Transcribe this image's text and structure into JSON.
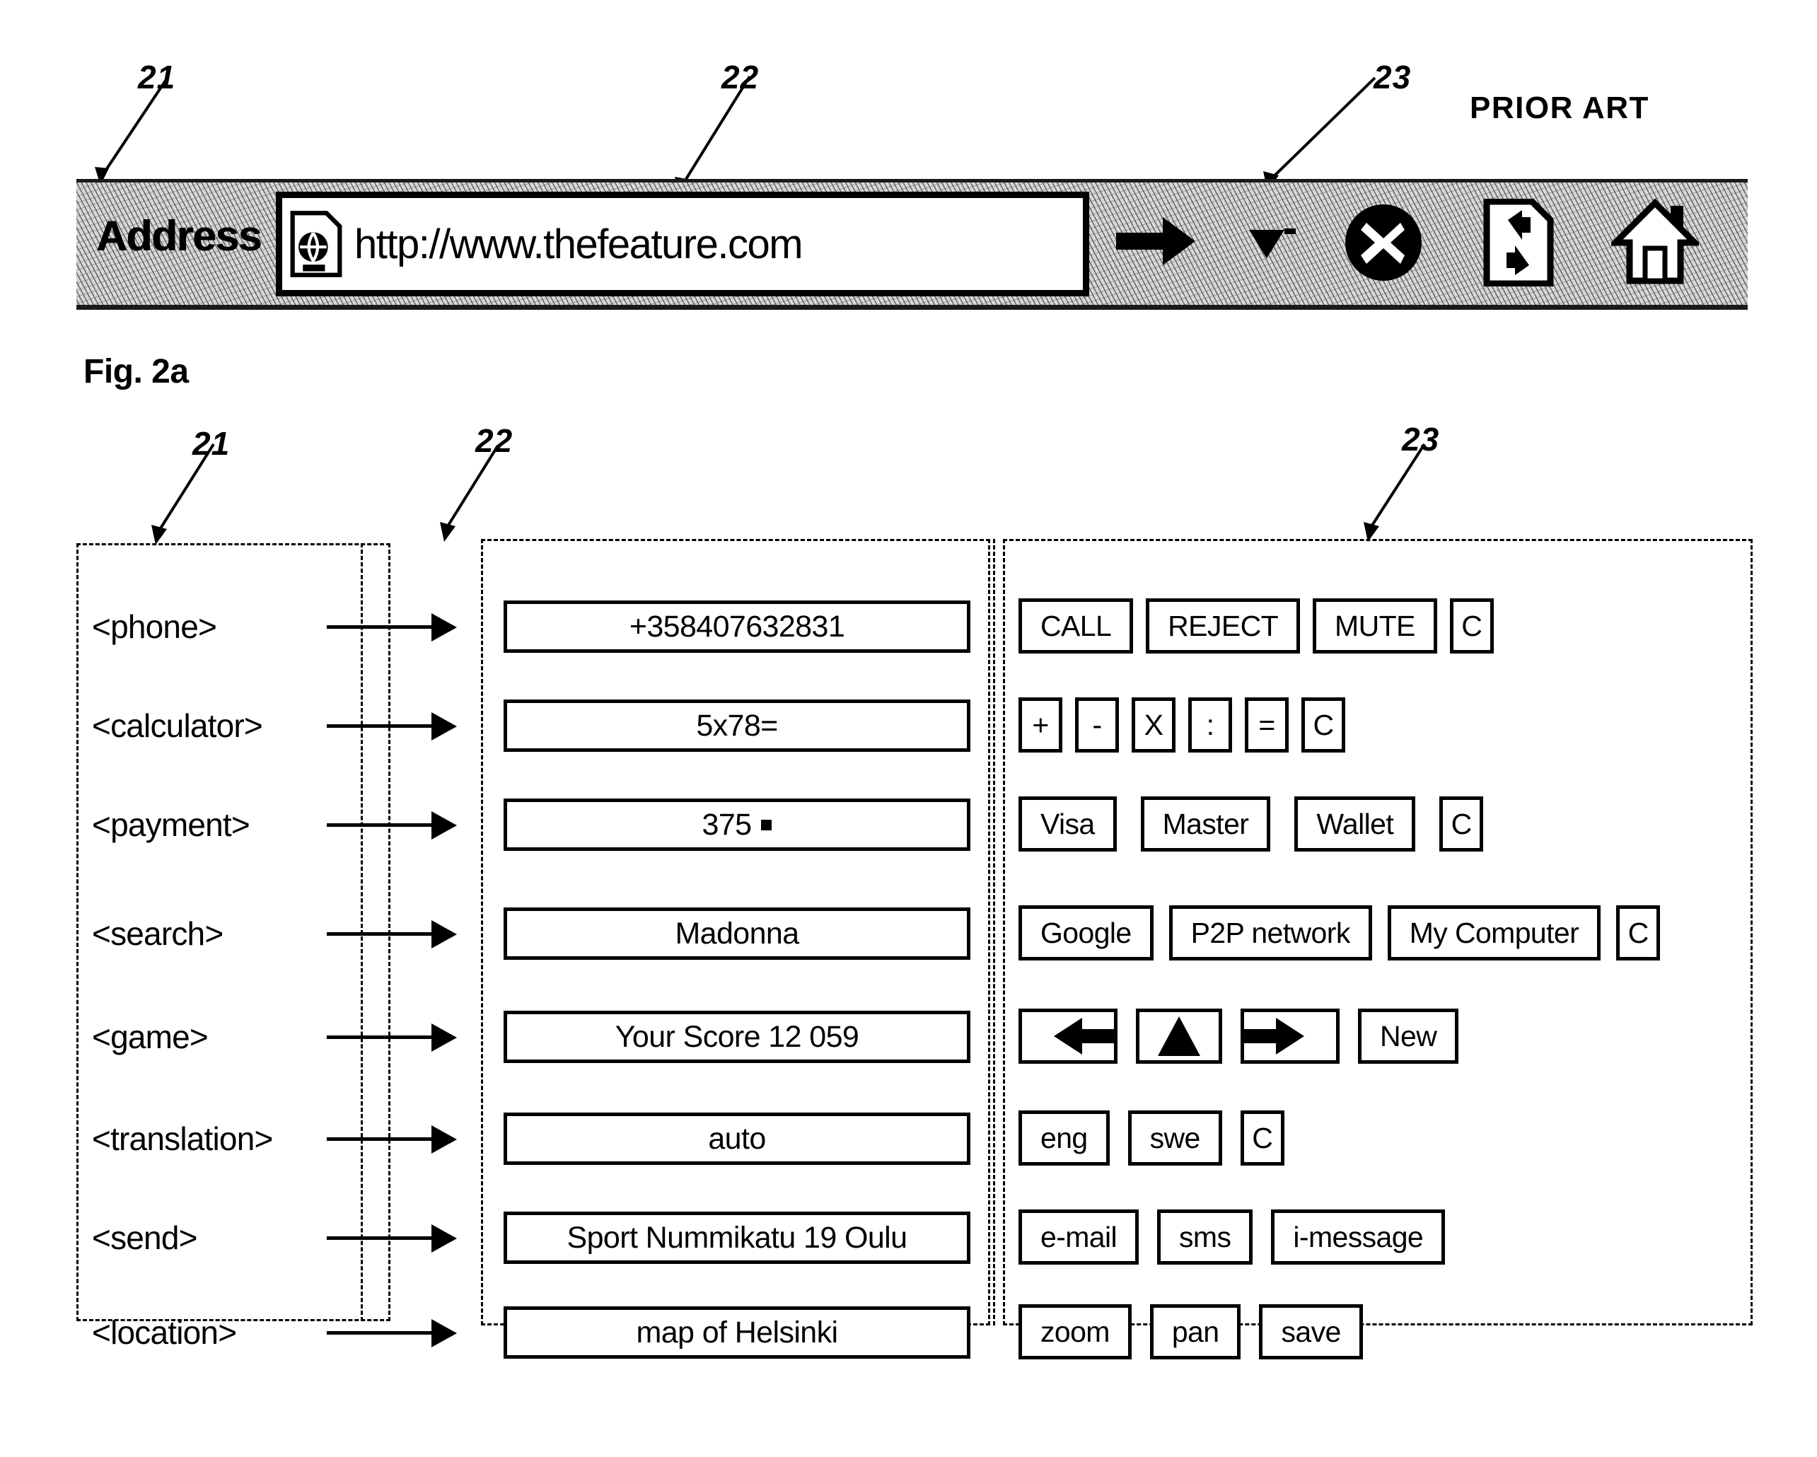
{
  "prior_art_label": "PRIOR ART",
  "fig_label": "Fig. 2a",
  "address_bar": {
    "label": "Address",
    "url": "http://www.thefeature.com",
    "favicon_icon": "document-globe-icon",
    "ref_21": "21",
    "ref_22": "22",
    "ref_23": "23",
    "icons": [
      {
        "name": "go-arrow-icon",
        "label": "Go"
      },
      {
        "name": "chevron-down-icon",
        "label": "History dropdown"
      },
      {
        "name": "stop-circle-x-icon",
        "label": "Stop"
      },
      {
        "name": "refresh-page-icon",
        "label": "Refresh"
      },
      {
        "name": "home-icon",
        "label": "Home"
      }
    ]
  },
  "diagram": {
    "ref_21": "21",
    "ref_22": "22",
    "ref_23": "23",
    "rows": [
      {
        "tag": "<phone>",
        "value": "+358407632831",
        "buttons": [
          {
            "label": "CALL",
            "kind": "wide"
          },
          {
            "label": "REJECT",
            "kind": "wide"
          },
          {
            "label": "MUTE",
            "kind": "wide"
          },
          {
            "label": "C",
            "kind": "square"
          }
        ]
      },
      {
        "tag": "<calculator>",
        "value": "5x78=",
        "buttons": [
          {
            "label": "+",
            "kind": "square"
          },
          {
            "label": "-",
            "kind": "square"
          },
          {
            "label": "X",
            "kind": "square"
          },
          {
            "label": ":",
            "kind": "square"
          },
          {
            "label": "=",
            "kind": "square"
          },
          {
            "label": "C",
            "kind": "square"
          }
        ]
      },
      {
        "tag": "<payment>",
        "value": "375",
        "value_suffix_icon": "square-bullet-icon",
        "buttons": [
          {
            "label": "Visa",
            "kind": "wide"
          },
          {
            "label": "Master",
            "kind": "wide"
          },
          {
            "label": "Wallet",
            "kind": "wide"
          },
          {
            "label": "C",
            "kind": "square"
          }
        ]
      },
      {
        "tag": "<search>",
        "value": "Madonna",
        "buttons": [
          {
            "label": "Google",
            "kind": "wide"
          },
          {
            "label": "P2P network",
            "kind": "wide"
          },
          {
            "label": "My Computer",
            "kind": "wide"
          },
          {
            "label": "C",
            "kind": "square"
          }
        ]
      },
      {
        "tag": "<game>",
        "value": "Your Score 12 059",
        "buttons": [
          {
            "label": "",
            "kind": "arrowbtn",
            "icon": "arrow-left-icon"
          },
          {
            "label": "",
            "kind": "arrowbtn",
            "icon": "arrow-up-icon"
          },
          {
            "label": "",
            "kind": "arrowbtn",
            "icon": "arrow-right-icon"
          },
          {
            "label": "New",
            "kind": "wide"
          }
        ]
      },
      {
        "tag": "<translation>",
        "value": "auto",
        "buttons": [
          {
            "label": "eng",
            "kind": "wide"
          },
          {
            "label": "swe",
            "kind": "wide"
          },
          {
            "label": "C",
            "kind": "square"
          }
        ]
      },
      {
        "tag": "<send>",
        "value": "Sport Nummikatu 19 Oulu",
        "buttons": [
          {
            "label": "e-mail",
            "kind": "wide"
          },
          {
            "label": "sms",
            "kind": "wide"
          },
          {
            "label": "i-message",
            "kind": "wide"
          }
        ]
      },
      {
        "tag": "<location>",
        "value": "map of Helsinki",
        "buttons": [
          {
            "label": "zoom",
            "kind": "wide"
          },
          {
            "label": "pan",
            "kind": "wide"
          },
          {
            "label": "save",
            "kind": "wide"
          }
        ]
      }
    ]
  }
}
